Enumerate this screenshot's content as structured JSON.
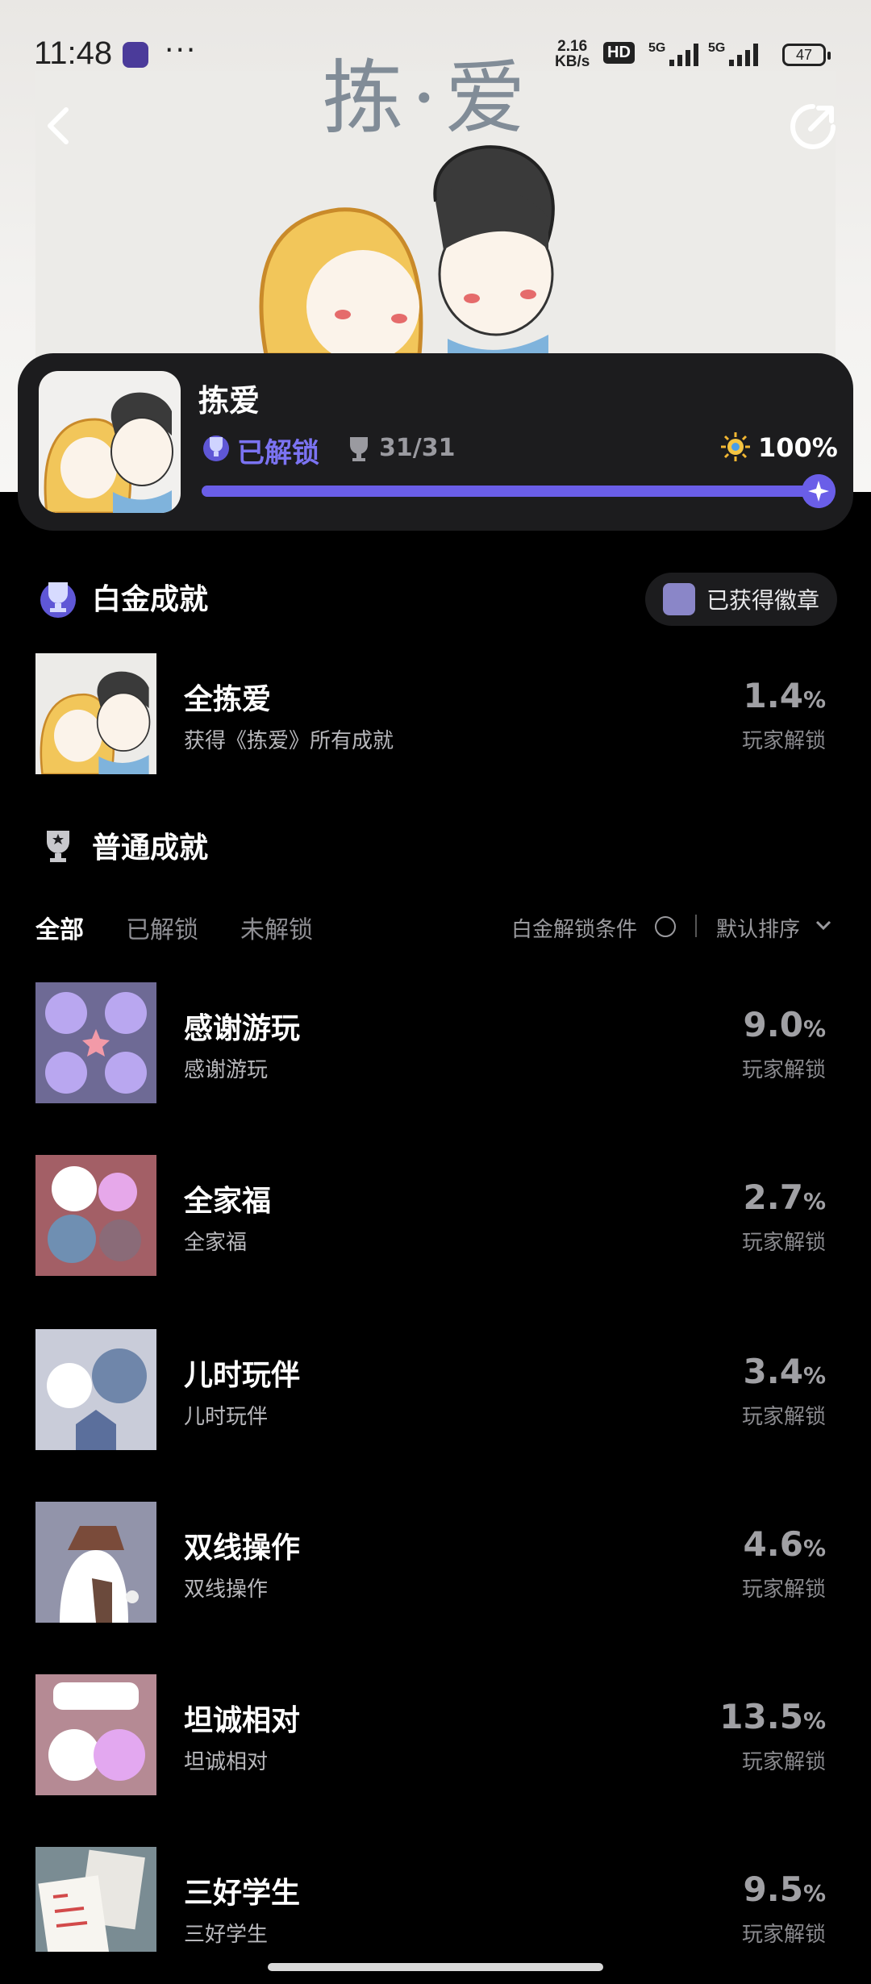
{
  "status_bar": {
    "time": "11:48",
    "more": "···",
    "net_speed_top": "2.16",
    "net_speed_bottom": "KB/s",
    "hd": "HD",
    "sig1": "5G",
    "sig2": "5G",
    "battery": "47"
  },
  "hero": {
    "title": "拣·爱"
  },
  "game": {
    "name": "拣爱",
    "unlock_label": "已解锁",
    "count": "31/31",
    "percent": "100%",
    "progress_fraction": 1.0
  },
  "platinum": {
    "header": "白金成就",
    "badge_button": "已获得徽章",
    "item": {
      "title": "全拣爱",
      "subtitle": "获得《拣爱》所有成就",
      "value": "1.4",
      "unit": "%",
      "label": "玩家解锁"
    }
  },
  "normal": {
    "header": "普通成就",
    "filters": {
      "all": "全部",
      "unlocked": "已解锁",
      "locked": "未解锁",
      "condition": "白金解锁条件",
      "sort": "默认排序"
    },
    "items": [
      {
        "title": "感谢游玩",
        "subtitle": "感谢游玩",
        "value": "9.0",
        "unit": "%",
        "label": "玩家解锁"
      },
      {
        "title": "全家福",
        "subtitle": "全家福",
        "value": "2.7",
        "unit": "%",
        "label": "玩家解锁"
      },
      {
        "title": "儿时玩伴",
        "subtitle": "儿时玩伴",
        "value": "3.4",
        "unit": "%",
        "label": "玩家解锁"
      },
      {
        "title": "双线操作",
        "subtitle": "双线操作",
        "value": "4.6",
        "unit": "%",
        "label": "玩家解锁"
      },
      {
        "title": "坦诚相对",
        "subtitle": "坦诚相对",
        "value": "13.5",
        "unit": "%",
        "label": "玩家解锁"
      },
      {
        "title": "三好学生",
        "subtitle": "三好学生",
        "value": "9.5",
        "unit": "%",
        "label": "玩家解锁"
      }
    ]
  }
}
